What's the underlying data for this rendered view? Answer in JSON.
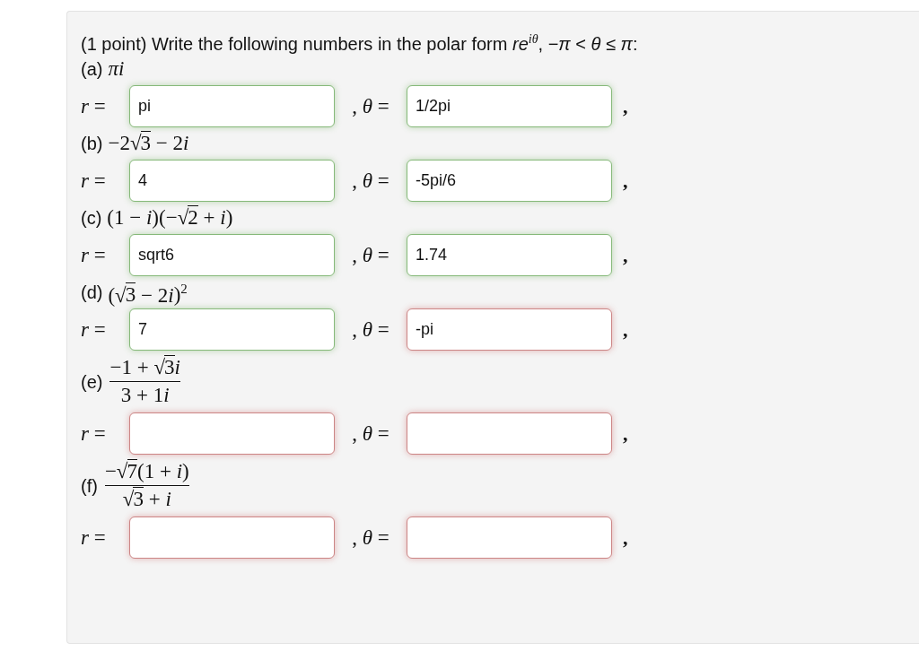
{
  "problem": {
    "statement": "(1 point) Write the following numbers in the polar form *re*$^{iθ}$, −*π* < *θ* ≤ *π*:"
  },
  "parts": [
    {
      "label": "(a)",
      "kind": "inline",
      "expression": [
        {
          "kind": "text",
          "text": "*πi*"
        }
      ],
      "answers": [
        {
          "prompt": "*r* =",
          "value": "pi",
          "correct": true
        },
        {
          "prompt": ", *θ* =",
          "value": "1/2pi",
          "correct": true
        }
      ],
      "suffix": ","
    },
    {
      "label": "(b)",
      "kind": "inline",
      "expression": [
        {
          "kind": "text",
          "text": "−2√"
        },
        {
          "kind": "radicand",
          "text": "3"
        },
        {
          "kind": "text",
          "text": " − 2"
        },
        {
          "kind": "text",
          "text": "*i*"
        }
      ],
      "answers": [
        {
          "prompt": "*r* =",
          "value": "4",
          "correct": true
        },
        {
          "prompt": ", *θ* =",
          "value": "-5pi/6",
          "correct": true
        }
      ],
      "suffix": ","
    },
    {
      "label": "(c)",
      "kind": "inline",
      "expression": [
        {
          "kind": "text",
          "text": "(1 − *i*)(−√"
        },
        {
          "kind": "radicand",
          "text": "2"
        },
        {
          "kind": "text",
          "text": " + *i*)"
        }
      ],
      "answers": [
        {
          "prompt": "*r* =",
          "value": "sqrt6",
          "correct": true
        },
        {
          "prompt": ", *θ* =",
          "value": "1.74",
          "correct": true
        }
      ],
      "suffix": ","
    },
    {
      "label": "(d)",
      "kind": "inline",
      "expression": [
        {
          "kind": "text",
          "text": "(√"
        },
        {
          "kind": "radicand",
          "text": "3"
        },
        {
          "kind": "text",
          "text": " − 2"
        },
        {
          "kind": "text",
          "text": "*i*"
        },
        {
          "kind": "text",
          "text": ")$^{2}$"
        }
      ],
      "answers": [
        {
          "prompt": "*r* =",
          "value": "7",
          "correct": true
        },
        {
          "prompt": ", *θ* =",
          "value": "-pi",
          "correct": false
        }
      ],
      "suffix": ","
    },
    {
      "label": "(e)",
      "kind": "fraction",
      "numerator": [
        {
          "kind": "text",
          "text": "−1 + √"
        },
        {
          "kind": "radicand",
          "text": "3"
        },
        {
          "kind": "text",
          "text": "*i*"
        }
      ],
      "denominator": [
        {
          "kind": "text",
          "text": "3 + 1"
        },
        {
          "kind": "text",
          "text": "*i*"
        }
      ],
      "answers": [
        {
          "prompt": "*r* =",
          "correct": false
        },
        {
          "prompt": ", *θ* =",
          "correct": false
        }
      ],
      "suffix": ","
    },
    {
      "label": "(f)",
      "kind": "fraction",
      "numerator": [
        {
          "kind": "text",
          "text": "−√"
        },
        {
          "kind": "radicand",
          "text": "7"
        },
        {
          "kind": "text",
          "text": "(1 + *i*)"
        }
      ],
      "denominator": [
        {
          "kind": "text",
          "text": "√"
        },
        {
          "kind": "radicand",
          "text": "3"
        },
        {
          "kind": "text",
          "text": " + *i*"
        }
      ],
      "answers": [
        {
          "prompt": "*r* =",
          "correct": false
        },
        {
          "prompt": ", *θ* =",
          "correct": false
        }
      ],
      "suffix": ","
    }
  ]
}
